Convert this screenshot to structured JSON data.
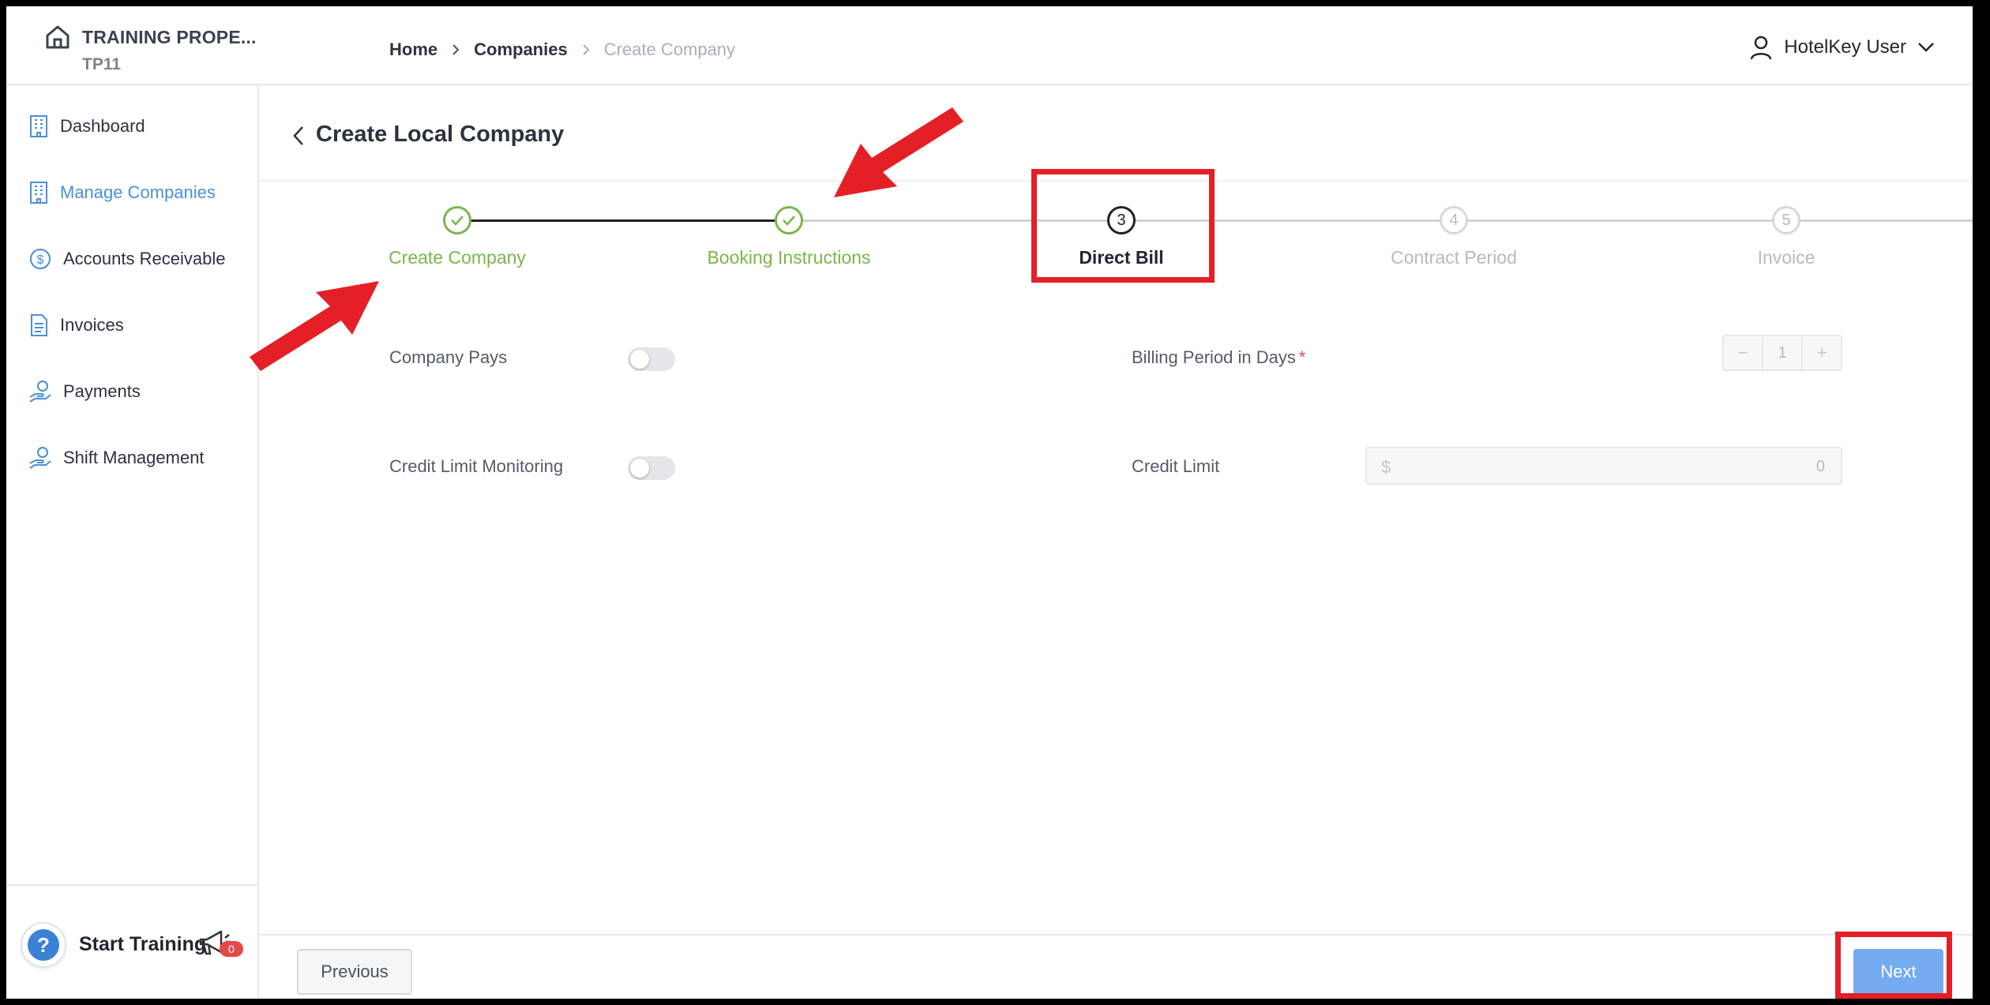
{
  "property": {
    "name": "TRAINING PROPE...",
    "code": "TP11"
  },
  "breadcrumb": {
    "home": "Home",
    "companies": "Companies",
    "current": "Create Company"
  },
  "user": {
    "name": "HotelKey User"
  },
  "sidebar": {
    "items": [
      {
        "label": "Dashboard",
        "icon": "building-icon"
      },
      {
        "label": "Manage Companies",
        "icon": "building-icon",
        "active": true
      },
      {
        "label": "Accounts Receivable",
        "icon": "dollar-circle-icon"
      },
      {
        "label": "Invoices",
        "icon": "document-icon"
      },
      {
        "label": "Payments",
        "icon": "hand-coin-icon"
      },
      {
        "label": "Shift Management",
        "icon": "hand-coin-icon"
      }
    ],
    "training": {
      "label": "Start Training",
      "badge": "0",
      "help": "?"
    }
  },
  "page": {
    "title": "Create Local Company"
  },
  "steps": [
    {
      "number": "1",
      "label": "Create Company",
      "status": "done"
    },
    {
      "number": "2",
      "label": "Booking Instructions",
      "status": "done"
    },
    {
      "number": "3",
      "label": "Direct Bill",
      "status": "current"
    },
    {
      "number": "4",
      "label": "Contract Period",
      "status": "pending"
    },
    {
      "number": "5",
      "label": "Invoice",
      "status": "pending"
    }
  ],
  "form": {
    "company_pays": {
      "label": "Company Pays",
      "on": false
    },
    "credit_limit_monitoring": {
      "label": "Credit Limit Monitoring",
      "on": false
    },
    "billing_period": {
      "label": "Billing Period in Days",
      "required_mark": "*",
      "value": "1",
      "minus": "−",
      "plus": "+"
    },
    "credit_limit": {
      "label": "Credit Limit",
      "currency": "$",
      "value": "0"
    }
  },
  "actions": {
    "previous": "Previous",
    "next": "Next"
  },
  "colors": {
    "accent": "#4a8fd6",
    "done": "#7ab648",
    "annotation": "#e41f26",
    "next_button": "#74abf0"
  }
}
